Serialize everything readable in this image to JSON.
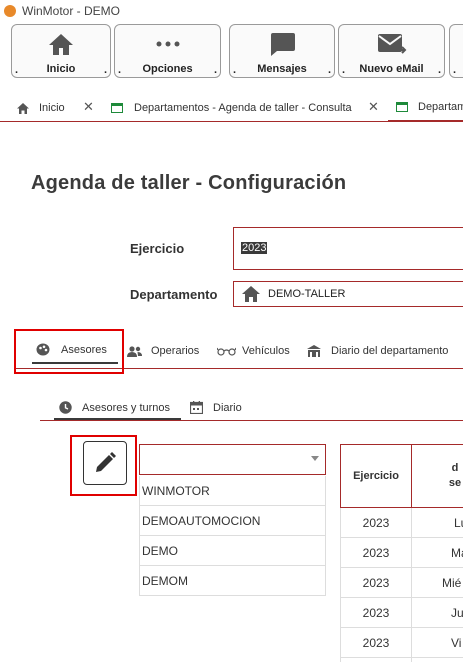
{
  "window": {
    "title": "WinMotor - DEMO"
  },
  "toolbar": {
    "buttons": [
      {
        "label": "Inicio",
        "icon": "home-icon"
      },
      {
        "label": "Opciones",
        "icon": "more-dots-icon"
      },
      {
        "label": "Mensajes",
        "icon": "message-icon"
      },
      {
        "label": "Nuevo eMail",
        "icon": "email-icon"
      }
    ],
    "dot": "."
  },
  "tabs": [
    {
      "label": "Inicio",
      "icon": "home-icon"
    },
    {
      "label": "Departamentos - Agenda de taller - Consulta",
      "icon": "window-icon"
    },
    {
      "label": "Departam",
      "icon": "window-icon"
    }
  ],
  "page": {
    "title": "Agenda de taller - Configuración",
    "ejercicio_label": "Ejercicio",
    "ejercicio_value": "2023",
    "departamento_label": "Departamento",
    "departamento_value": "DEMO-TALLER"
  },
  "section_tabs": [
    {
      "label": "Asesores",
      "icon": "palette-icon",
      "active": true
    },
    {
      "label": "Operarios",
      "icon": "people-icon"
    },
    {
      "label": "Vehículos",
      "icon": "glasses-icon"
    },
    {
      "label": "Diario del departamento",
      "icon": "building-icon"
    }
  ],
  "sub_tabs": [
    {
      "label": "Asesores y turnos",
      "icon": "clock-icon",
      "active": true
    },
    {
      "label": "Diario",
      "icon": "calendar-icon"
    }
  ],
  "asesores": {
    "combo_value": "",
    "items": [
      "WINMOTOR",
      "DEMOAUTOMOCION",
      "DEMO",
      "DEMOM"
    ]
  },
  "table": {
    "headers": [
      "Ejercicio",
      "d se"
    ],
    "rows": [
      {
        "ejercicio": "2023",
        "dia": "Lu"
      },
      {
        "ejercicio": "2023",
        "dia": "Ma"
      },
      {
        "ejercicio": "2023",
        "dia": "Mié"
      },
      {
        "ejercicio": "2023",
        "dia": "Ju"
      },
      {
        "ejercicio": "2023",
        "dia": "Vi"
      }
    ]
  },
  "colors": {
    "accent": "#a52a2a",
    "highlight_box": "#e00000"
  }
}
